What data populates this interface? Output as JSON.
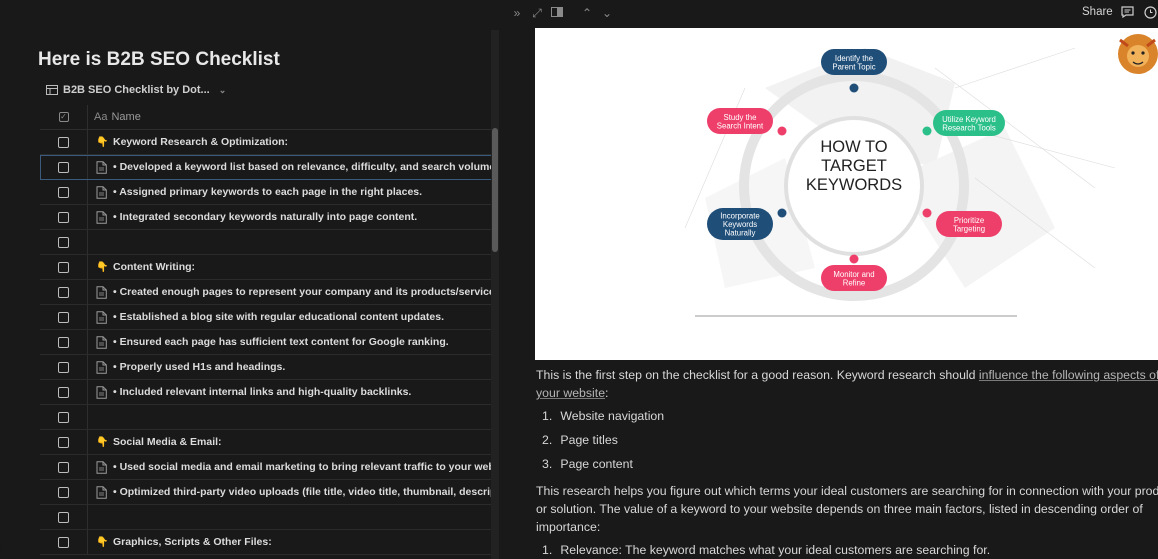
{
  "left": {
    "title": "Here is B2B SEO Checklist",
    "db_view_label": "B2B SEO Checklist by Dot...",
    "name_header_prefix": "Aa",
    "name_header": "Name",
    "rows": [
      {
        "type": "section",
        "text": "Keyword Research & Optimization:"
      },
      {
        "type": "item",
        "text": "• Developed a keyword list based on relevance, difficulty, and search volume.",
        "selected": true
      },
      {
        "type": "item",
        "text": "• Assigned primary keywords to each page in the right places."
      },
      {
        "type": "item",
        "text": "• Integrated secondary keywords naturally into page content."
      },
      {
        "type": "empty",
        "text": ""
      },
      {
        "type": "section",
        "text": "Content Writing:"
      },
      {
        "type": "item",
        "text": "• Created enough pages to represent your company and its products/services."
      },
      {
        "type": "item",
        "text": "• Established a blog site with regular educational content updates."
      },
      {
        "type": "item",
        "text": "• Ensured each page has sufficient text content for Google ranking."
      },
      {
        "type": "item",
        "text": "• Properly used H1s and headings."
      },
      {
        "type": "item",
        "text": "• Included relevant internal links and high-quality backlinks."
      },
      {
        "type": "empty",
        "text": ""
      },
      {
        "type": "section",
        "text": "Social Media & Email:"
      },
      {
        "type": "item",
        "text": "• Used social media and email marketing to bring relevant traffic to your websit"
      },
      {
        "type": "item",
        "text": "• Optimized third-party video uploads (file title, video title, thumbnail, descripti"
      },
      {
        "type": "empty",
        "text": ""
      },
      {
        "type": "section",
        "text": "Graphics, Scripts & Other Files:"
      }
    ]
  },
  "topbar": {
    "share_label": "Share"
  },
  "infographic": {
    "center_title": [
      "HOW TO",
      "TARGET",
      "KEYWORDS"
    ],
    "nodes": [
      {
        "label": [
          "Identify the",
          "Parent Topic"
        ],
        "color": "#1f4e79"
      },
      {
        "label": [
          "Utilize Keyword",
          "Research Tools"
        ],
        "color": "#2bbf8a"
      },
      {
        "label": [
          "Prioritize",
          "Targeting"
        ],
        "color": "#ee3e6a"
      },
      {
        "label": [
          "Monitor and",
          "Refine"
        ],
        "color": "#ee3e6a"
      },
      {
        "label": [
          "Incorporate",
          "Keywords",
          "Naturally"
        ],
        "color": "#1f4e79"
      },
      {
        "label": [
          "Study the",
          "Search Intent"
        ],
        "color": "#ee3e6a"
      }
    ]
  },
  "content": {
    "intro_text": "This is the first step on the checklist for a good reason. Keyword research should ",
    "intro_link": "influence the following aspects of your website",
    "intro_end": ":",
    "list1": [
      {
        "num": "1.",
        "text": "Website navigation"
      },
      {
        "num": "2.",
        "text": "Page titles"
      },
      {
        "num": "3.",
        "text": "Page content"
      }
    ],
    "para2": "This research helps you figure out which terms your ideal customers are searching for in connection with your product or solution. The value of a keyword to your website depends on three main factors, listed in descending order of importance:",
    "list2": [
      {
        "num": "1.",
        "text": "Relevance: The keyword matches what your ideal customers are searching for."
      }
    ]
  }
}
